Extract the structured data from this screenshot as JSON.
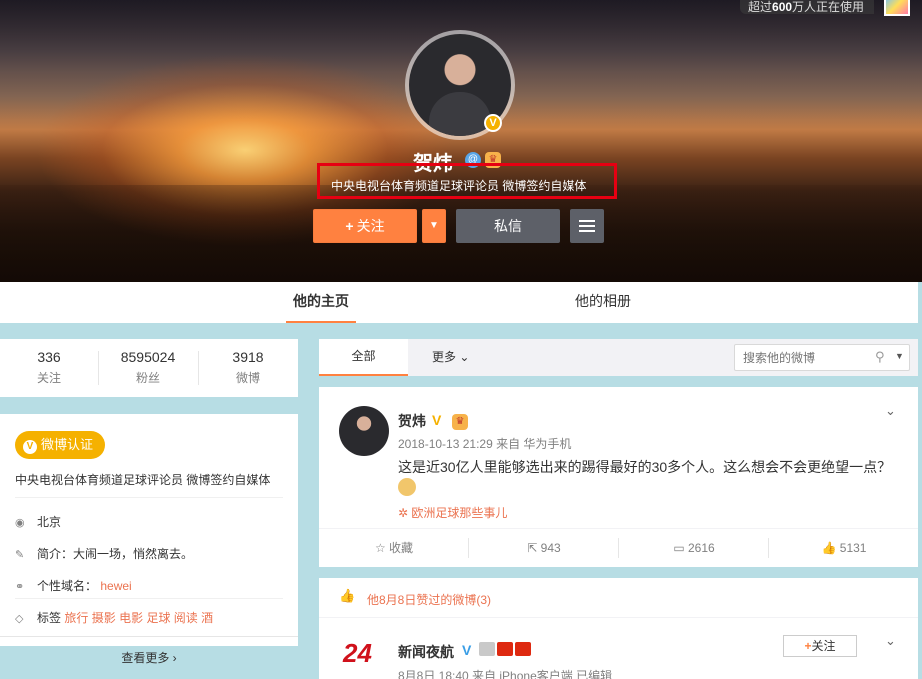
{
  "banner": {
    "online_badge_prefix": "超过",
    "online_badge_count": "600",
    "online_badge_suffix": "万人正在使用"
  },
  "profile": {
    "name": "贺炜",
    "verify_badge": "V",
    "description": "中央电视台体育频道足球评论员 微博签约自媒体",
    "follow_label": "关注",
    "follow_plus": "+",
    "dropdown_arrow": "▼",
    "message_label": "私信"
  },
  "tabs": [
    {
      "label": "他的主页",
      "active": true
    },
    {
      "label": "他的相册",
      "active": false
    }
  ],
  "stats": [
    {
      "value": "336",
      "label": "关注"
    },
    {
      "value": "8595024",
      "label": "粉丝"
    },
    {
      "value": "3918",
      "label": "微博"
    }
  ],
  "info": {
    "verify_tag": "微博认证",
    "verify_icon": "V",
    "verify_desc": "中央电视台体育频道足球评论员 微博签约自媒体",
    "location": "北京",
    "intro_label": "简介：",
    "intro_value": "大闹一场，悄然离去。",
    "domain_label": "个性域名：",
    "domain_value": "hewei",
    "tags_label": "标签",
    "tags": [
      "旅行",
      "摄影",
      "电影",
      "足球",
      "阅读",
      "酒"
    ],
    "see_more": "查看更多",
    "see_more_arrow": "›"
  },
  "feed": {
    "tab_all": "全部",
    "tab_more": "更多",
    "tab_more_arrow": "⌄",
    "search_placeholder": "搜索他的微博",
    "post": {
      "author": "贺炜",
      "verify": "V",
      "meta": "2018-10-13 21:29 来自 华为手机",
      "text": "这是近30亿人里能够选出来的踢得最好的30多个人。这么想会不会更绝望一点？",
      "topic": "欧洲足球那些事儿",
      "actions": {
        "favorite": "收藏",
        "repost": "943",
        "comment": "2616",
        "like": "5131"
      }
    },
    "liked_header": "他8月8日赞过的微博(3)",
    "liked_post": {
      "author": "新闻夜航",
      "logo_text": "24",
      "verify": "V",
      "meta": "8月8日 18:40 来自 iPhone客户端  已编辑",
      "follow_label": "关注",
      "follow_plus": "+"
    }
  },
  "colors": {
    "accent": "#ff8140",
    "link": "#eb7350",
    "verify_gold": "#f5b100",
    "highlight_box": "#e60012",
    "page_bg": "#b7dde4"
  }
}
